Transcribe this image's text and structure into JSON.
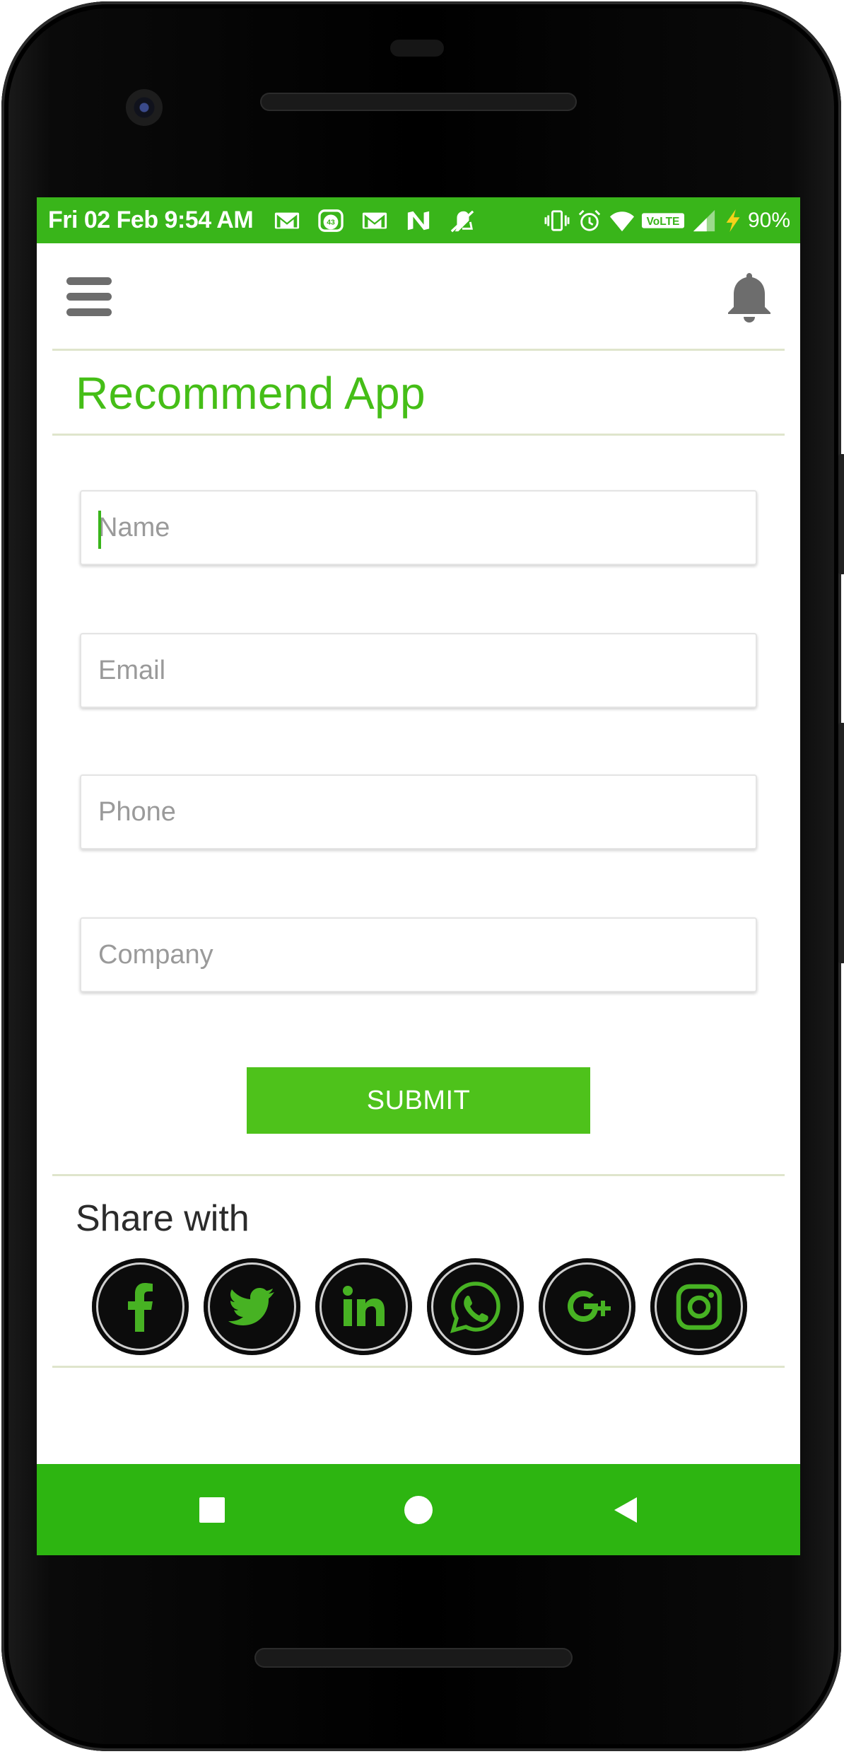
{
  "colors": {
    "accent_green": "#45be17",
    "status_bar": "#39b51a",
    "nav_bar": "#2db511",
    "submit_button": "#4ec21b",
    "divider": "#dfe5cc"
  },
  "status_bar": {
    "time": "Fri 02 Feb 9:54 AM",
    "notification_icons": [
      "gmail-icon",
      "badge-43-icon",
      "gmail-icon",
      "n-app-icon",
      "mute-icon"
    ],
    "badge_number": "43",
    "system_icons": [
      "vibrate-icon",
      "alarm-icon",
      "wifi-icon",
      "volte-icon",
      "signal-icon",
      "charging-icon"
    ],
    "volte_label": "VoLTE",
    "battery": "90%"
  },
  "toolbar": {
    "menu_icon": "hamburger-menu-icon",
    "notification_icon": "bell-icon"
  },
  "page": {
    "title": "Recommend App"
  },
  "form": {
    "name_placeholder": "Name",
    "email_placeholder": "Email",
    "phone_placeholder": "Phone",
    "company_placeholder": "Company",
    "submit_label": "SUBMIT"
  },
  "share": {
    "label": "Share with",
    "networks": [
      "facebook",
      "twitter",
      "linkedin",
      "whatsapp",
      "google-plus",
      "instagram"
    ]
  },
  "nav_bar": {
    "buttons": [
      "recents-square-icon",
      "home-circle-icon",
      "back-triangle-icon"
    ]
  }
}
